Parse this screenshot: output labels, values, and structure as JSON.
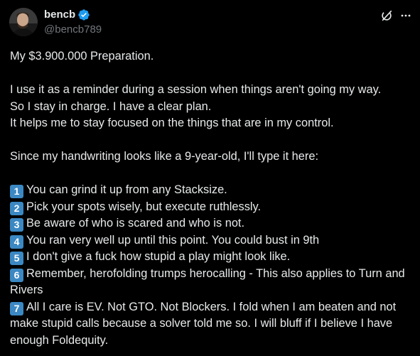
{
  "header": {
    "display_name": "bencb",
    "handle": "@bencb789"
  },
  "tweet": {
    "title_line": "My $3.900.000 Preparation.",
    "para1": [
      "I use it as a reminder during a session when things aren't going my way.",
      "So I stay in charge. I have a clear plan.",
      "It helps me to stay focused on the things that are in my control."
    ],
    "para2": "Since my handwriting looks like a 9-year-old, I'll type it here:",
    "items": [
      {
        "num": "1",
        "text": "You can grind it up from any Stacksize."
      },
      {
        "num": "2",
        "text": "Pick your spots wisely, but execute ruthlessly."
      },
      {
        "num": "3",
        "text": "Be aware of who is scared and who is not."
      },
      {
        "num": "4",
        "text": "You ran very well up until this point. You could bust in 9th"
      },
      {
        "num": "5",
        "text": "I don't give a fuck how stupid a play might look like."
      },
      {
        "num": "6",
        "text": "Remember, herofolding trumps herocalling - This also applies to Turn and Rivers"
      },
      {
        "num": "7",
        "text": "All I care is EV. Not GTO. Not Blockers. I fold when I am beaten and not make stupid calls because a solver told me so. I will bluff if I believe I have enough Foldequity."
      }
    ]
  },
  "colors": {
    "background": "#000000",
    "text": "#e7e9ea",
    "secondary": "#71767b",
    "verified": "#1d9bf0",
    "keycap": "#3b88c3"
  },
  "icons": {
    "verified": "verified-badge-icon",
    "grok": "grok-icon",
    "more": "more-horizontal-icon"
  }
}
